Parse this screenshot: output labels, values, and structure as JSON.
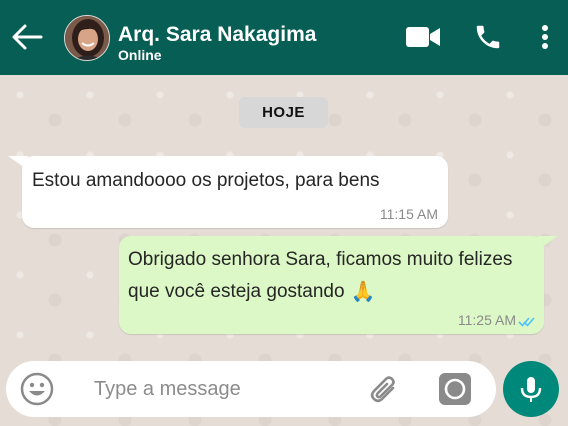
{
  "header": {
    "contact_name": "Arq. Sara Nakagima",
    "status": "Online"
  },
  "icons": {
    "back": "arrow-left-icon",
    "video": "video-camera-icon",
    "call": "phone-icon",
    "menu": "more-vertical-icon",
    "emoji": "emoji-icon",
    "attach": "paperclip-icon",
    "camera": "camera-icon",
    "mic": "microphone-icon"
  },
  "day_badge": "HOJE",
  "messages": [
    {
      "direction": "incoming",
      "text": "Estou amandoooo os projetos, para bens",
      "time": "11:15 AM"
    },
    {
      "direction": "outgoing",
      "text": "Obrigado senhora Sara, ficamos muito felizes que você esteja gostando",
      "emoji": "🙏",
      "time": "11:25 AM",
      "read_status": "double-check-read"
    }
  ],
  "composer": {
    "placeholder": "Type a message",
    "value": ""
  },
  "colors": {
    "header_bg": "#075e54",
    "chat_bg": "#e5ddd5",
    "incoming_bubble": "#ffffff",
    "outgoing_bubble": "#dcf8c6",
    "mic_button": "#00897b",
    "read_ticks": "#4fc3f7"
  }
}
